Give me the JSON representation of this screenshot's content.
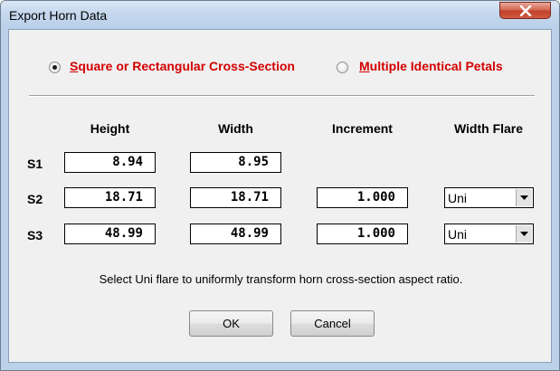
{
  "window": {
    "title": "Export Horn Data"
  },
  "options": {
    "square": {
      "accel": "S",
      "rest": "quare or Rectangular Cross-Section",
      "selected": true
    },
    "petals": {
      "accel": "M",
      "rest": "ultiple Identical Petals",
      "selected": false
    }
  },
  "columns": {
    "height": "Height",
    "width": "Width",
    "increment": "Increment",
    "width_flare": "Width Flare"
  },
  "rows": [
    {
      "label": "S1",
      "height": "8.94",
      "width": "8.95"
    },
    {
      "label": "S2",
      "height": "18.71",
      "width": "18.71",
      "increment": "1.000",
      "flare": "Uni"
    },
    {
      "label": "S3",
      "height": "48.99",
      "width": "48.99",
      "increment": "1.000",
      "flare": "Uni"
    }
  ],
  "hint": "Select Uni flare to uniformly transform horn cross-section aspect ratio.",
  "buttons": {
    "ok": "OK",
    "cancel": "Cancel"
  },
  "icons": {
    "close": "close-icon",
    "dropdown": "chevron-down-icon"
  },
  "colors": {
    "accent_label": "#d40000",
    "titlebar": "#c6d8ee",
    "close_button": "#c2402a",
    "dialog_bg": "#f0f0f0"
  }
}
